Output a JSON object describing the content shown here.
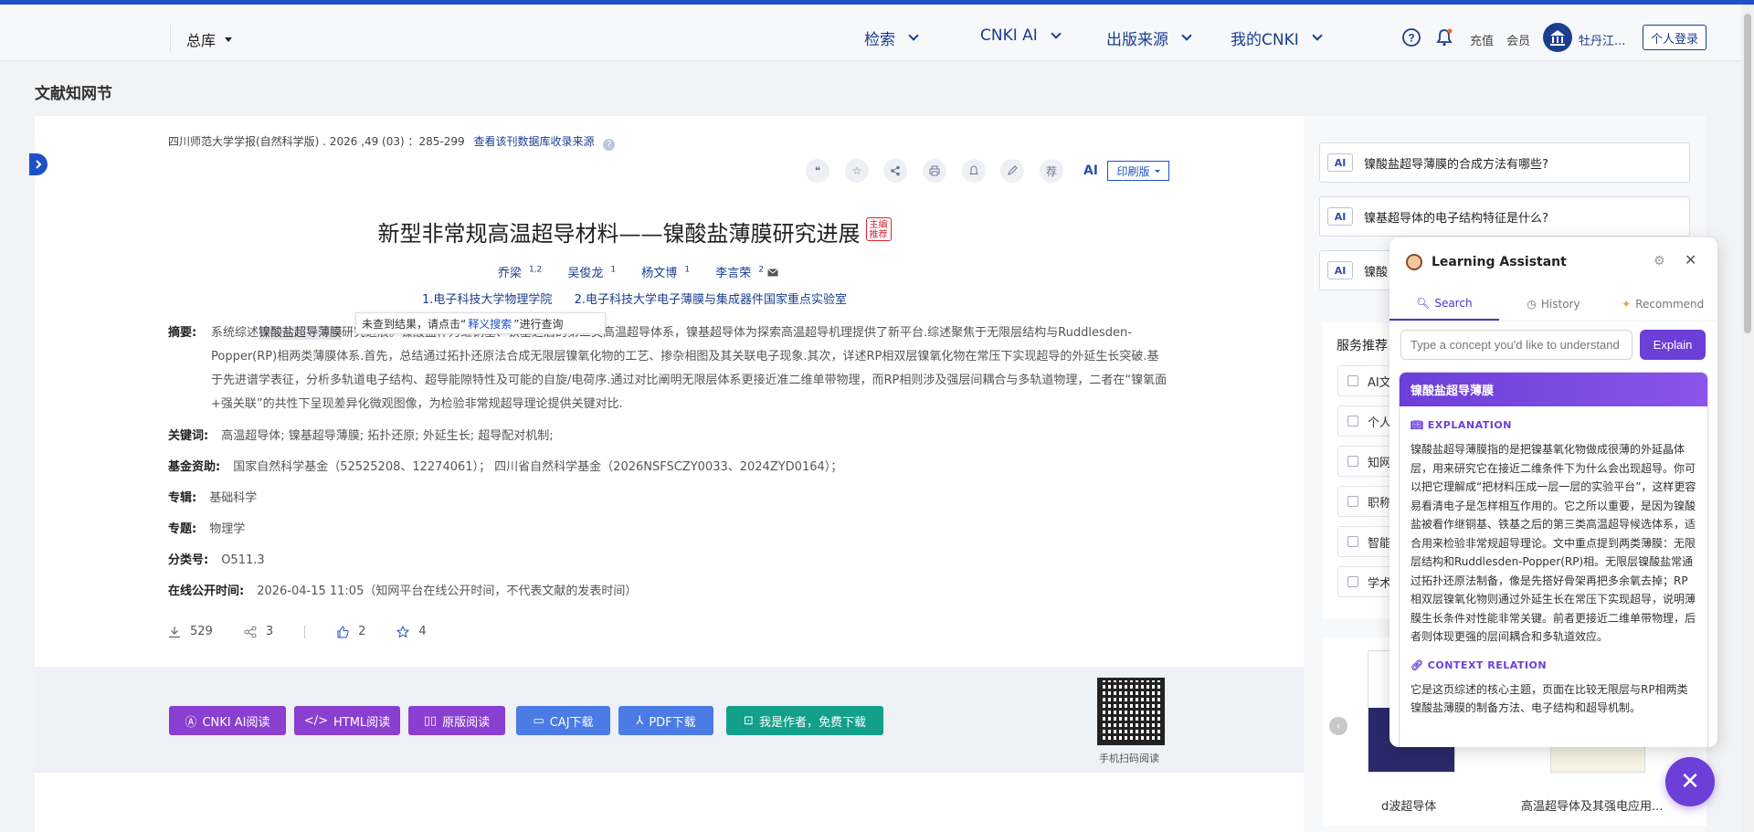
{
  "header": {
    "database": "总库",
    "nav": [
      "检索",
      "CNKI AI",
      "出版来源",
      "我的CNKI"
    ],
    "recharge": "充值",
    "member": "会员",
    "username": "牡丹江...",
    "login": "个人登录"
  },
  "page_heading": "文献知网节",
  "article": {
    "source": "四川师范大学学报(自然科学版) . 2026 ,49 (03) ：285-299",
    "source_link": "查看该刊数据库收录来源",
    "print_label": "印刷版",
    "title": "新型非常规高温超导材料——镍酸盐薄膜研究进展",
    "badge": "主编推荐",
    "authors": [
      {
        "name": "乔梁",
        "sup": "1,2"
      },
      {
        "name": "吴俊龙",
        "sup": "1"
      },
      {
        "name": "杨文博",
        "sup": "1"
      },
      {
        "name": "李言荣",
        "sup": "2"
      }
    ],
    "affiliations": [
      "1.电子科技大学物理学院",
      "2.电子科技大学电子薄膜与集成器件国家重点实验室"
    ],
    "abstract_label": "摘要:",
    "abstract_pre": "系统综述",
    "abstract_highlight": "镍酸盐超导薄膜",
    "abstract_line1_rest": "研究进展。镍酸盐作为继铜基、铁基之后的第三类高温超导体系，镍基超导体为探索高温超导机理提供了新平台.综述聚焦于无限层结构与Ruddlesden-",
    "abstract_rest": "Popper(RP)相两类薄膜体系.首先，总结通过拓扑还原法合成无限层镍氧化物的工艺、掺杂相图及其关联电子现象.其次，详述RP相双层镍氧化物在常压下实现超导的外延生长突破.基于先进谱学表征，分析多轨道电子结构、超导能隙特性及可能的自旋/电荷序.通过对比阐明无限层体系更接近准二维单带物理，而RP相则涉及强层间耦合与多轨道物理，二者在“镍氧面+强关联”的共性下呈现差异化微观图像，为检验非常规超导理论提供关键对比.",
    "tooltip_pre": "未查到结果，请点击“",
    "tooltip_link": "释义搜索",
    "tooltip_post": "”进行查询",
    "keywords_label": "关键词:",
    "keywords": "高温超导体;  镍基超导薄膜;  拓扑还原;  外延生长;  超导配对机制;",
    "fund_label": "基金资助:",
    "fund": "国家自然科学基金（52525208、12274061）；  四川省自然科学基金（2026NSFSCZY0033、2024ZYD0164）；",
    "series_label": "专辑:",
    "series": "基础科学",
    "topic_label": "专题:",
    "topic": "物理学",
    "class_label": "分类号:",
    "class": "O511.3",
    "online_label": "在线公开时间:",
    "online": "2026-04-15 11:05（知网平台在线公开时间，不代表文献的发表时间）",
    "stats": {
      "downloads": "529",
      "shares": "3",
      "likes": "2",
      "favorites": "4"
    }
  },
  "downloads": {
    "buttons": [
      "CNKI AI阅读",
      "HTML阅读",
      "原版阅读",
      "CAJ下载",
      "PDF下载",
      "我是作者，免费下载"
    ],
    "colors": [
      "#8a3fd0",
      "#8a3fd0",
      "#8a3fd0",
      "#4b7be5",
      "#4b7be5",
      "#12a08a"
    ],
    "qr_label": "手机扫码阅读"
  },
  "right": {
    "questions": [
      "镍酸盐超导薄膜的合成方法有哪些?",
      "镍基超导体的电子结构特征是什么?",
      "镍酸"
    ],
    "ai_tag": "AI",
    "service_title": "服务推荐",
    "services": [
      "AI文",
      "个人",
      "知网",
      "职称",
      "智能",
      "学术"
    ],
    "books": [
      "d波超导体",
      "高温超导体及其强电应用..."
    ]
  },
  "assistant": {
    "title": "Learning Assistant",
    "tabs": [
      "Search",
      "History",
      "Recommend"
    ],
    "input_placeholder": "Type a concept you'd like to understand",
    "explain_button": "Explain",
    "term": "镍酸盐超导薄膜",
    "section1": "EXPLANATION",
    "explanation": "镍酸盐超导薄膜指的是把镍基氧化物做成很薄的外延晶体层，用来研究它在接近二维条件下为什么会出现超导。你可以把它理解成“把材料压成一层一层的实验平台”，这样更容易看清电子是怎样相互作用的。它之所以重要，是因为镍酸盐被看作继铜基、铁基之后的第三类高温超导候选体系，适合用来检验非常规超导理论。文中重点提到两类薄膜：无限层结构和Ruddlesden-Popper(RP)相。无限层镍酸盐常通过拓扑还原法制备，像是先搭好骨架再把多余氧去掉；RP相双层镍氧化物则通过外延生长在常压下实现超导，说明薄膜生长条件对性能非常关键。前者更接近二维单带物理，后者则体现更强的层间耦合和多轨道效应。",
    "section2": "CONTEXT RELATION",
    "context": "它是这页综述的核心主题，页面在比较无限层与RP相两类镍酸盐薄膜的制备方法、电子结构和超导机制。"
  }
}
